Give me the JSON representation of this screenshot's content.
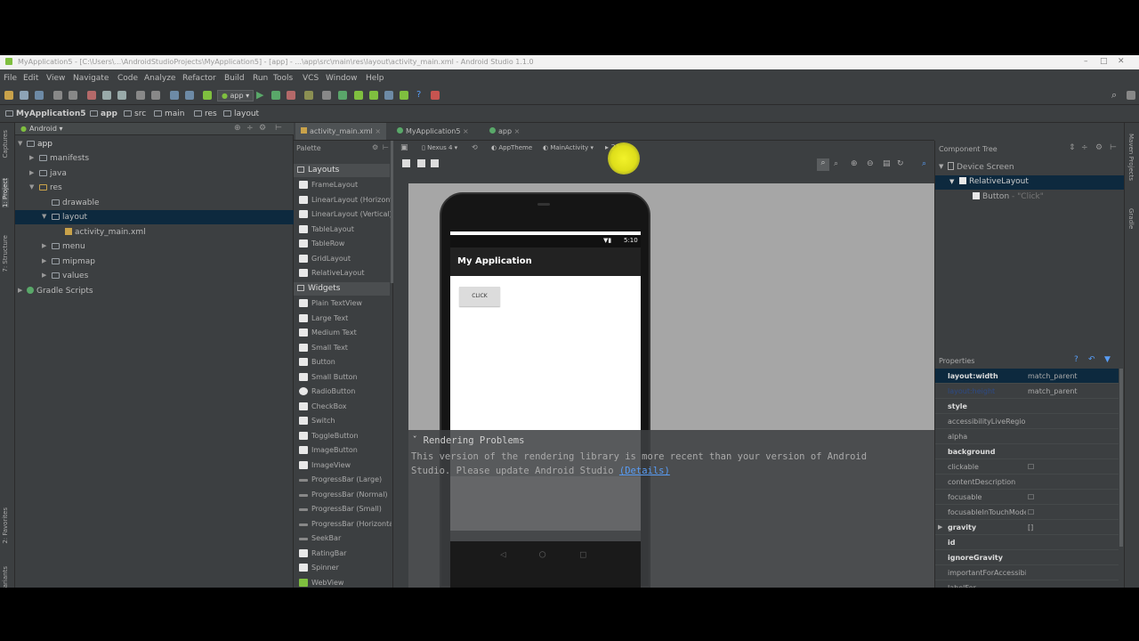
{
  "window": {
    "title": "MyApplication5 - [C:\\Users\\...\\AndroidStudioProjects\\MyApplication5] - [app] - ...\\app\\src\\main\\res\\layout\\activity_main.xml - Android Studio 1.1.0"
  },
  "menu": [
    "File",
    "Edit",
    "View",
    "Navigate",
    "Code",
    "Analyze",
    "Refactor",
    "Build",
    "Run",
    "Tools",
    "VCS",
    "Window",
    "Help"
  ],
  "toolbar": {
    "run_config": "app"
  },
  "breadcrumb": [
    "MyApplication5",
    "app",
    "src",
    "main",
    "res",
    "layout"
  ],
  "left_strip": [
    "1: Project",
    "7: Structure",
    "Captures",
    "2: Favorites",
    "Build Variants"
  ],
  "right_strip": [
    "Maven Projects",
    "Gradle"
  ],
  "project": {
    "view_mode": "Android",
    "tree": [
      {
        "label": "app",
        "depth": 0,
        "expanded": true
      },
      {
        "label": "manifests",
        "depth": 1
      },
      {
        "label": "java",
        "depth": 1
      },
      {
        "label": "res",
        "depth": 1,
        "expanded": true
      },
      {
        "label": "drawable",
        "depth": 2
      },
      {
        "label": "layout",
        "depth": 2,
        "expanded": true,
        "selected": true
      },
      {
        "label": "activity_main.xml",
        "depth": 3
      },
      {
        "label": "menu",
        "depth": 2
      },
      {
        "label": "mipmap",
        "depth": 2
      },
      {
        "label": "values",
        "depth": 2
      },
      {
        "label": "Gradle Scripts",
        "depth": 0
      }
    ]
  },
  "editor_tabs": [
    {
      "label": "activity_main.xml",
      "active": true
    },
    {
      "label": "MyApplication5",
      "active": false
    },
    {
      "label": "app",
      "active": false
    }
  ],
  "palette": {
    "title": "Palette",
    "categories": [
      {
        "name": "Layouts",
        "items": [
          "FrameLayout",
          "LinearLayout (Horizontal)",
          "LinearLayout (Vertical)",
          "TableLayout",
          "TableRow",
          "GridLayout",
          "RelativeLayout"
        ]
      },
      {
        "name": "Widgets",
        "items": [
          "Plain TextView",
          "Large Text",
          "Medium Text",
          "Small Text",
          "Button",
          "Small Button",
          "RadioButton",
          "CheckBox",
          "Switch",
          "ToggleButton",
          "ImageButton",
          "ImageView",
          "ProgressBar (Large)",
          "ProgressBar (Normal)",
          "ProgressBar (Small)",
          "ProgressBar (Horizontal)",
          "SeekBar",
          "RatingBar",
          "Spinner",
          "WebView"
        ]
      }
    ]
  },
  "design_toolbar": {
    "device": "Nexus 4",
    "theme": "AppTheme",
    "activity": "MainActivity",
    "api": "21"
  },
  "device_preview": {
    "time": "5:10",
    "app_title": "My Application",
    "button_label": "CLICK"
  },
  "render_error": {
    "title": "Rendering Problems",
    "message": "This version of the rendering library is more recent than your version of Android Studio. Please update Android Studio",
    "link": "(Details)"
  },
  "component_tree": {
    "title": "Component Tree",
    "nodes": [
      {
        "label": "Device Screen",
        "depth": 0
      },
      {
        "label": "RelativeLayout",
        "depth": 1,
        "selected": true
      },
      {
        "label": "Button",
        "depth": 2,
        "extra": "- \"Click\""
      }
    ]
  },
  "properties": {
    "title": "Properties",
    "rows": [
      {
        "name": "layout:width",
        "value": "match_parent",
        "bold": true,
        "selected": true
      },
      {
        "name": "layout:height",
        "value": "match_parent",
        "bold": false
      },
      {
        "name": "style",
        "value": "",
        "bold": true
      },
      {
        "name": "accessibilityLiveRegion",
        "value": "",
        "bold": false
      },
      {
        "name": "alpha",
        "value": "",
        "bold": false
      },
      {
        "name": "background",
        "value": "",
        "bold": true
      },
      {
        "name": "clickable",
        "value": "☐",
        "bold": false
      },
      {
        "name": "contentDescription",
        "value": "",
        "bold": false
      },
      {
        "name": "focusable",
        "value": "☐",
        "bold": false
      },
      {
        "name": "focusableInTouchMode",
        "value": "☐",
        "bold": false
      },
      {
        "name": "gravity",
        "value": "[]",
        "bold": true,
        "expandable": true
      },
      {
        "name": "id",
        "value": "",
        "bold": true
      },
      {
        "name": "ignoreGravity",
        "value": "",
        "bold": true
      },
      {
        "name": "importantForAccessibility",
        "value": "",
        "bold": false
      },
      {
        "name": "labelFor",
        "value": "",
        "bold": false
      }
    ]
  },
  "colors": {
    "ide_bg": "#3c3f41",
    "selection": "#0d293e",
    "accent": "#6a8759",
    "link": "#589df6",
    "error_title": "#d0d0d0",
    "highlight": "#f2f22a"
  }
}
